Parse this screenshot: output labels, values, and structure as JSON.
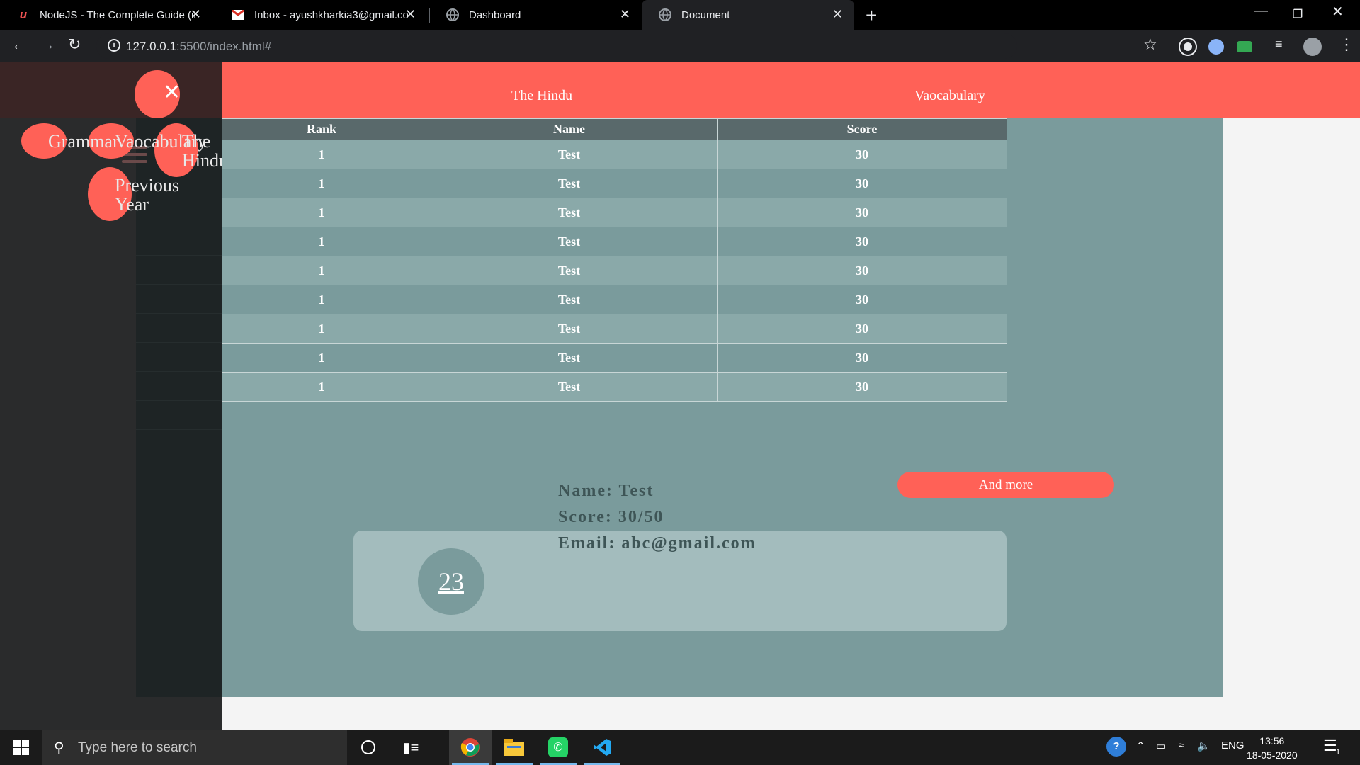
{
  "browser": {
    "tabs": [
      {
        "title": "NodeJS - The Complete Guide (in",
        "icon": "udemy-icon",
        "active": false
      },
      {
        "title": "Inbox - ayushkharkia3@gmail.co",
        "icon": "gmail-icon",
        "active": false
      },
      {
        "title": "Dashboard",
        "icon": "globe-icon",
        "active": false
      },
      {
        "title": "Document",
        "icon": "globe-icon",
        "active": true
      }
    ],
    "url_host": "127.0.0.1",
    "url_rest": ":5500/index.html#"
  },
  "nav": {
    "link1": "The Hindu",
    "link2": "Vaocabulary"
  },
  "menu": {
    "grammar": "Grammar",
    "vocabulary": "Vaocabulary",
    "the_hindu_a": "The",
    "the_hindu_b": "Hindu",
    "prev_a": "Previous",
    "prev_b": "Year"
  },
  "table": {
    "headers": [
      "Rank",
      "Name",
      "Score"
    ],
    "rows": [
      [
        "1",
        "Test",
        "30"
      ],
      [
        "1",
        "Test",
        "30"
      ],
      [
        "1",
        "Test",
        "30"
      ],
      [
        "1",
        "Test",
        "30"
      ],
      [
        "1",
        "Test",
        "30"
      ],
      [
        "1",
        "Test",
        "30"
      ],
      [
        "1",
        "Test",
        "30"
      ],
      [
        "1",
        "Test",
        "30"
      ],
      [
        "1",
        "Test",
        "30"
      ]
    ]
  },
  "more_button": "And more",
  "profile": {
    "rank": "23",
    "name_line": "Name: Test",
    "score_line": "Score: 30/50",
    "email_line": "Email: abc@gmail.com"
  },
  "taskbar": {
    "search_placeholder": "Type here to search",
    "lang": "ENG",
    "time": "13:56",
    "date": "18-05-2020",
    "notif_count": "1"
  },
  "colors": {
    "accent": "#ff6157",
    "main_bg": "#7a9b9c",
    "header_bg": "#59696b"
  }
}
